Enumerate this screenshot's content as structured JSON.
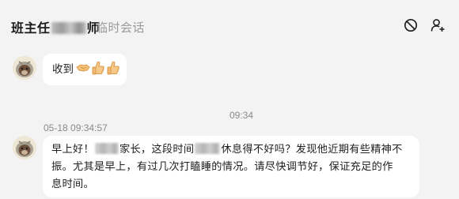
{
  "header": {
    "title_prefix": "班主任",
    "title_suffix": "师",
    "subtitle": "临时会话",
    "icons": [
      "block-icon",
      "add-user-icon"
    ]
  },
  "messages": [
    {
      "text": "收到",
      "emoji": [
        "handshake-emoji",
        "thumbs-up-emoji",
        "thumbs-up-emoji"
      ]
    },
    {
      "center_time": "09:34",
      "timestamp": "05-18 09:34:57",
      "line1_a": "早上好！",
      "line1_b": "家长，这段时间",
      "line1_c": "休息得不好吗？发现他近期有些精神不",
      "line2": "振。尤其是早上，有过几次打瞌睡的情况。请尽快调节好，保证充足的作",
      "line3": "息时间。"
    }
  ],
  "colors": {
    "background": "#f3f3f3",
    "bubble": "#ffffff",
    "muted_text": "#8a8a8a"
  }
}
